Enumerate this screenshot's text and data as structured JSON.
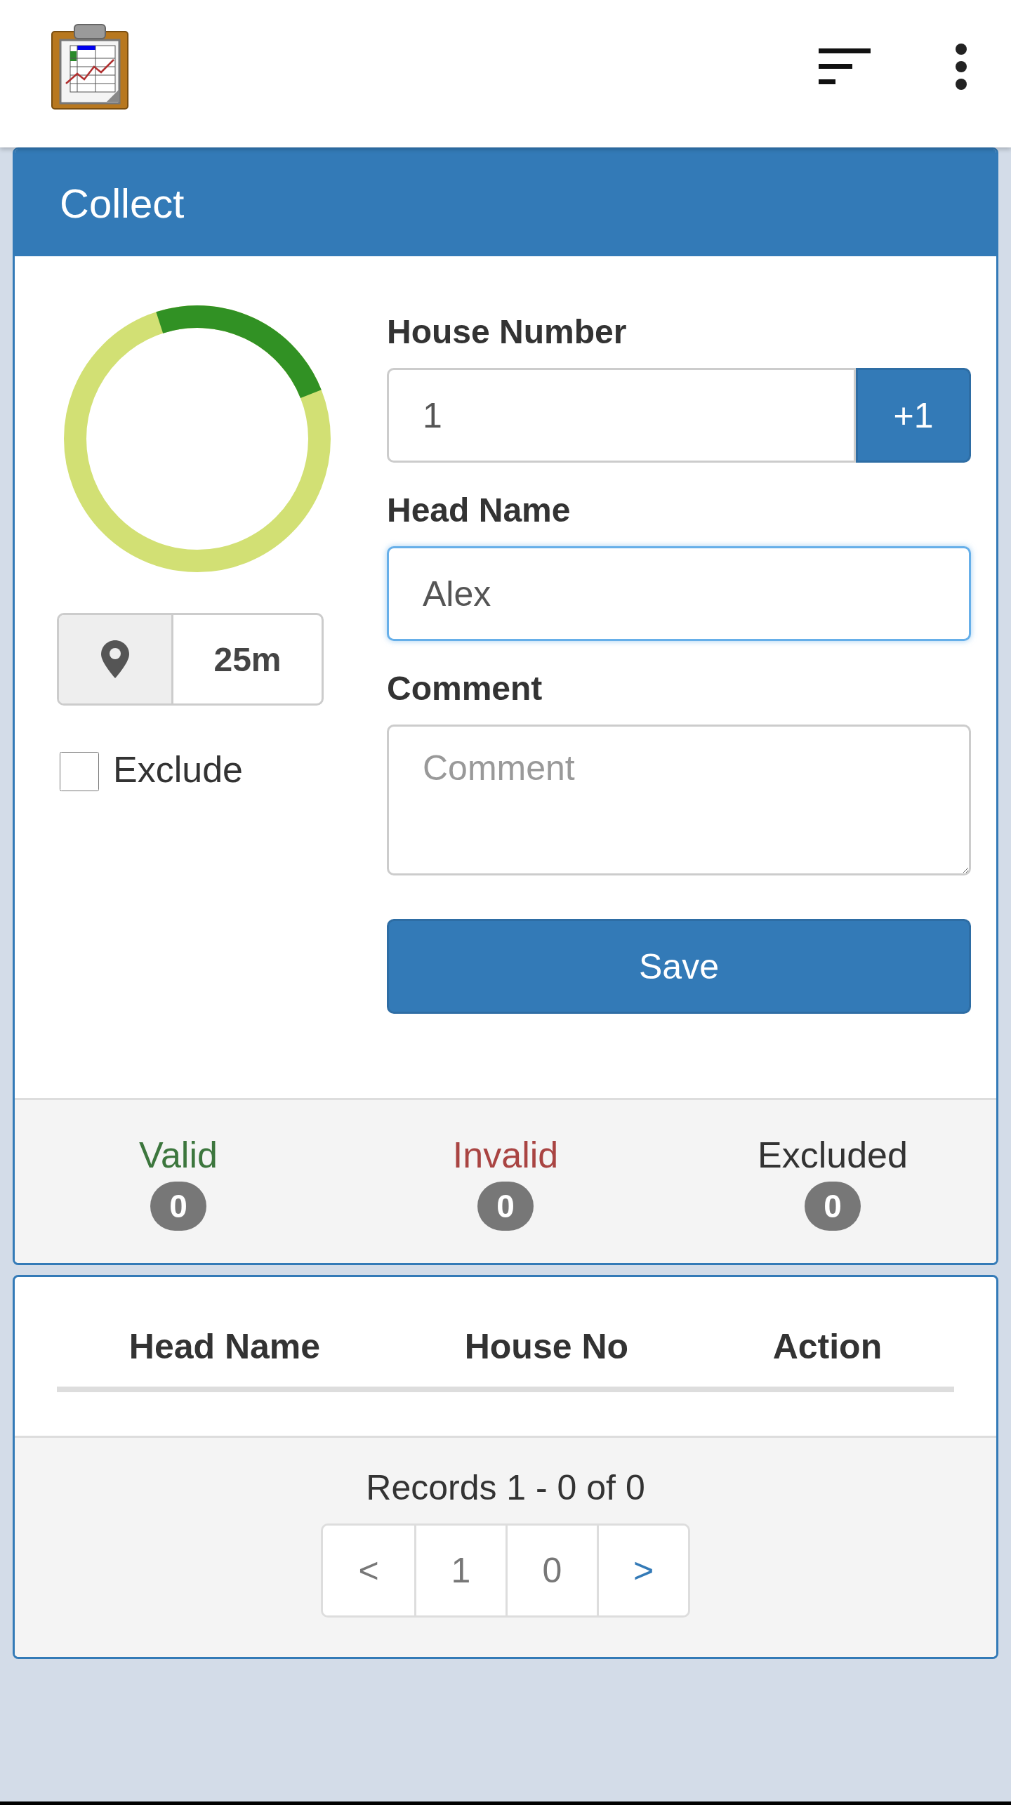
{
  "panel": {
    "title": "Collect"
  },
  "progress_ring": {
    "level": 0.24
  },
  "location": {
    "accuracy": "25m"
  },
  "exclude": {
    "label": "Exclude",
    "checked": false
  },
  "form": {
    "fields": [
      {
        "kind": "increment",
        "label": "House Number",
        "value": "1",
        "button": "+1",
        "focused": false
      },
      {
        "kind": "text",
        "label": "Head Name",
        "value": "Alex",
        "focused": true
      },
      {
        "kind": "textarea",
        "label": "Comment",
        "placeholder": "Comment",
        "focused": false
      }
    ],
    "save": "Save"
  },
  "stats": [
    {
      "label": "Valid",
      "count": "0",
      "color": "#3c763d"
    },
    {
      "label": "Invalid",
      "count": "0",
      "color": "#a94442"
    },
    {
      "label": "Excluded",
      "count": "0",
      "color": "#333333"
    }
  ],
  "table": {
    "columns": [
      "Head Name",
      "House No",
      "Action"
    ]
  },
  "records": "Records 1 - 0 of 0",
  "pagination": [
    {
      "label": "<",
      "kind": "prev"
    },
    {
      "label": "1",
      "kind": "page"
    },
    {
      "label": "0",
      "kind": "page"
    },
    {
      "label": ">",
      "kind": "next"
    }
  ]
}
